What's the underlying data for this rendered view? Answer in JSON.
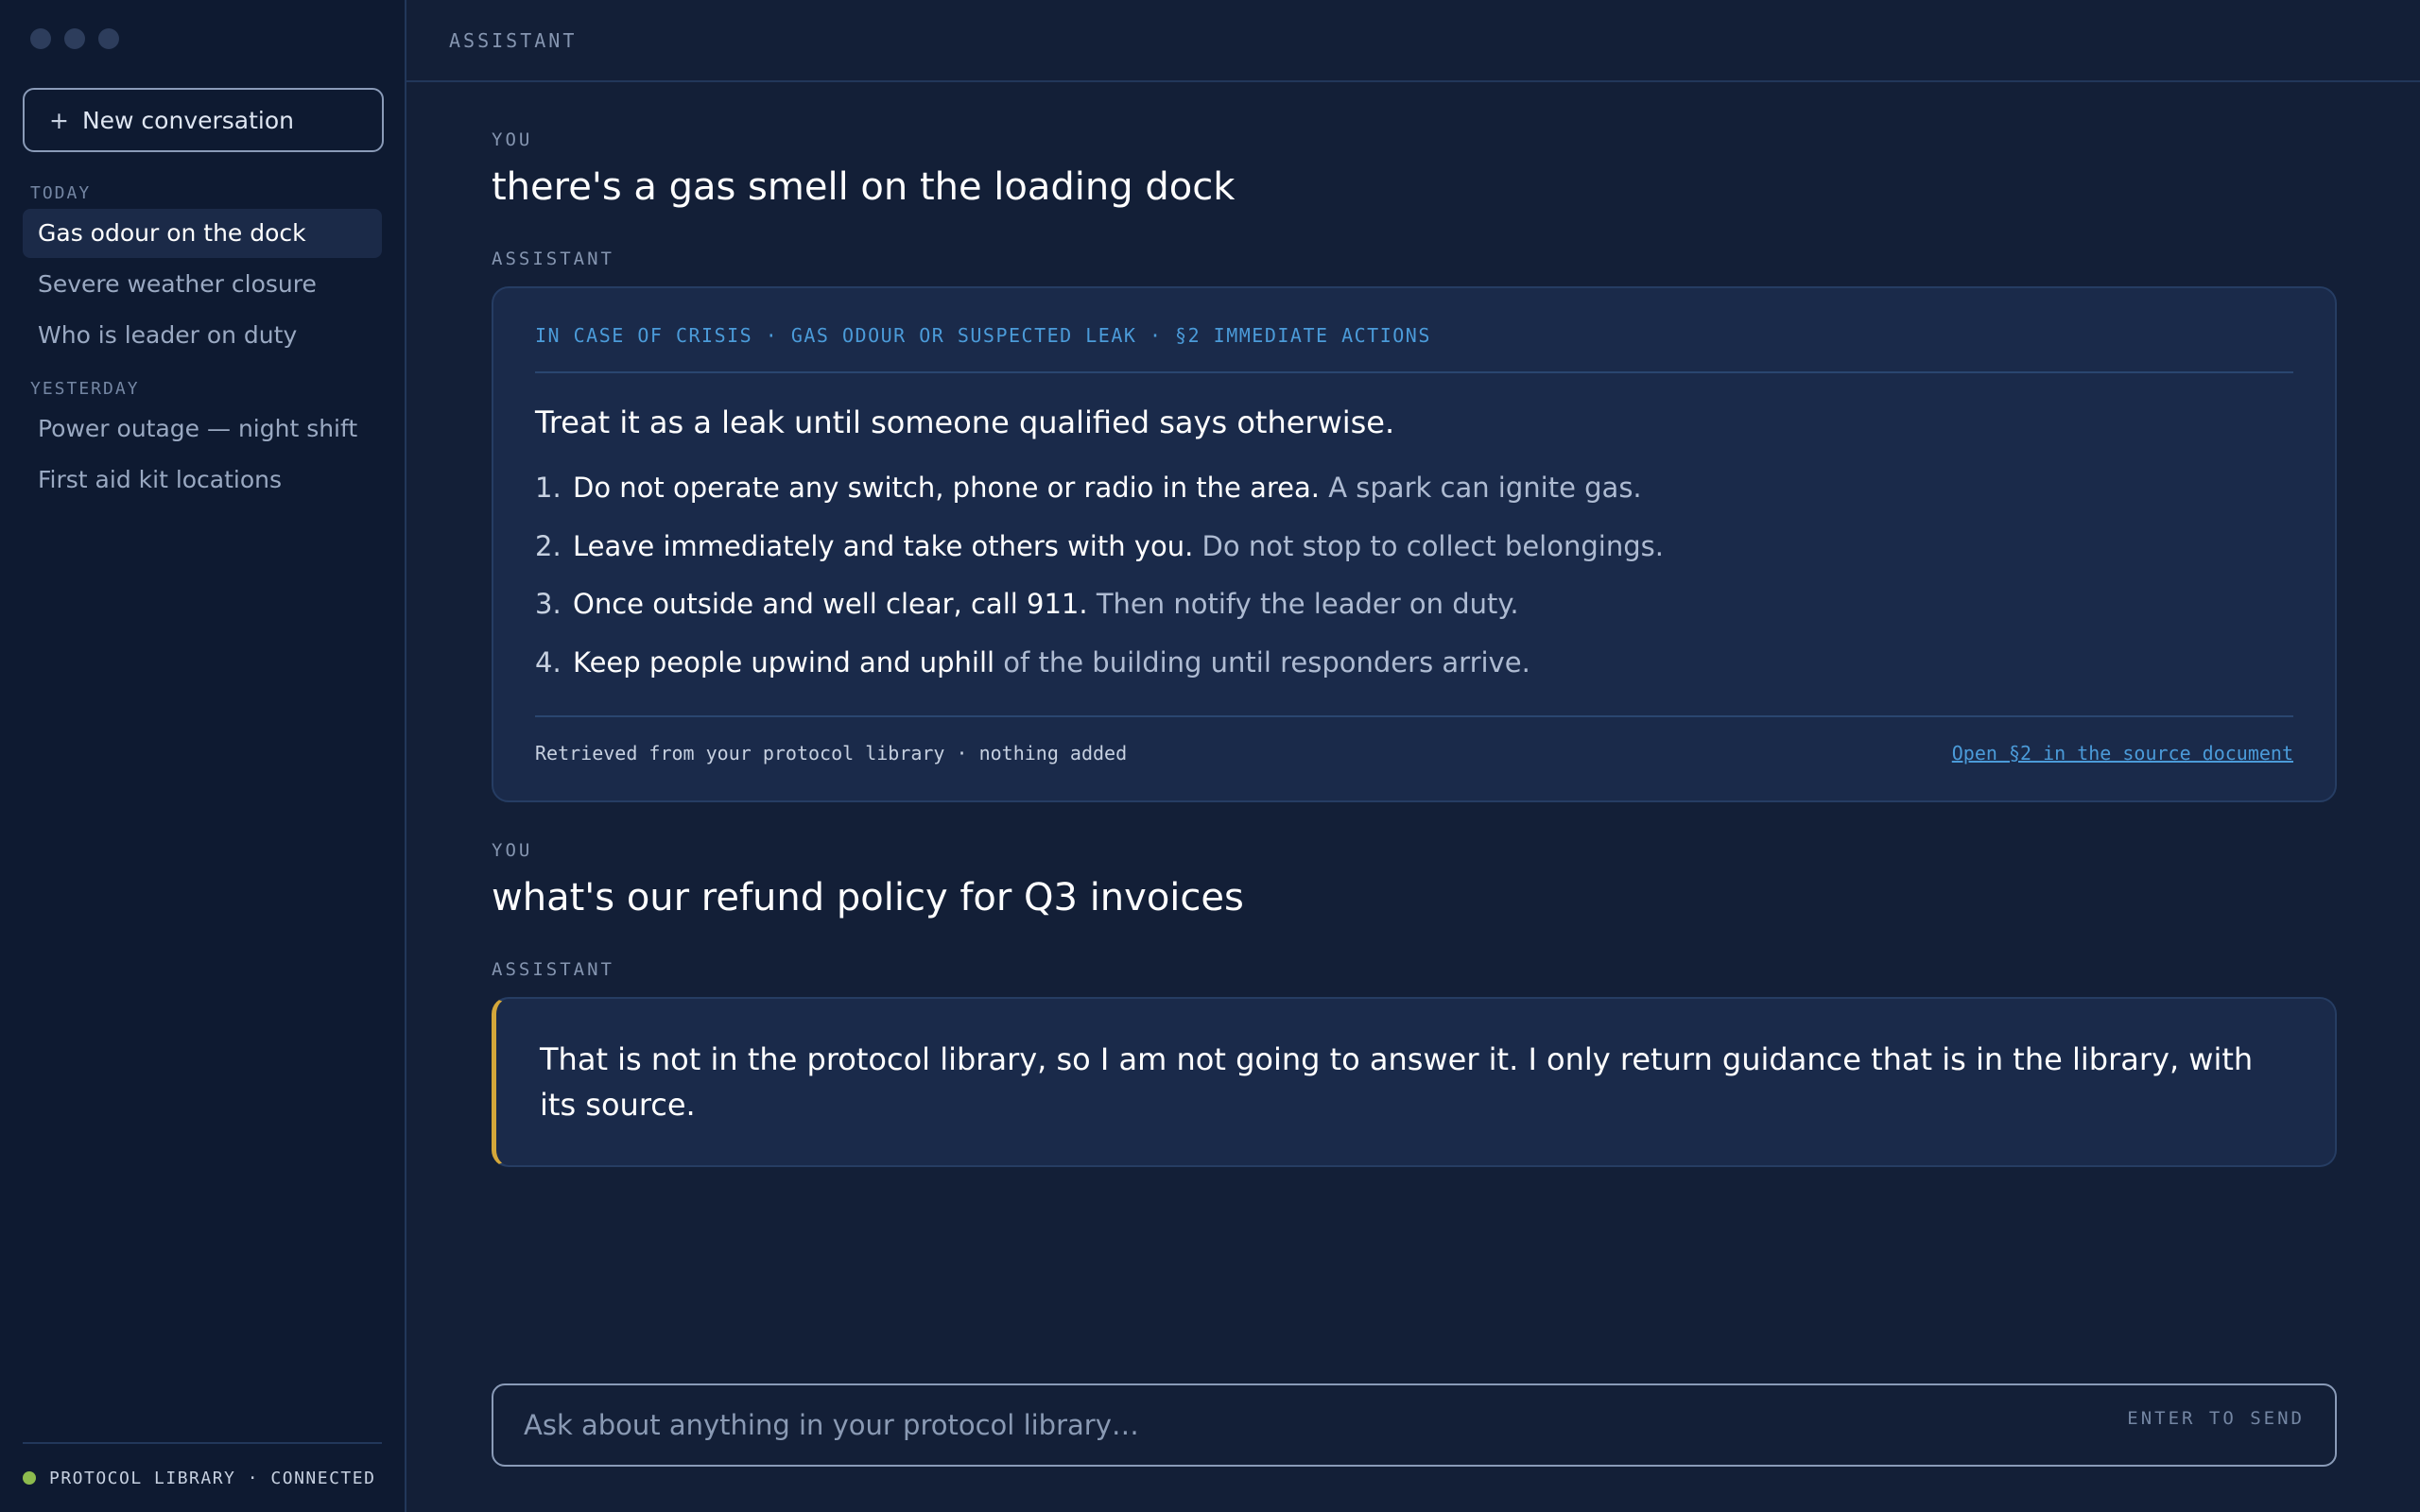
{
  "sidebar": {
    "new_conversation_icon": "+",
    "new_conversation_label": "New conversation",
    "today_label": "TODAY",
    "today_items": [
      {
        "label": "Gas odour on the dock"
      },
      {
        "label": "Severe weather closure"
      },
      {
        "label": "Who is leader on duty"
      }
    ],
    "yesterday_label": "YESTERDAY",
    "yesterday_items": [
      {
        "label": "Power outage — night shift"
      },
      {
        "label": "First aid kit locations"
      }
    ],
    "footer_status": "PROTOCOL LIBRARY · CONNECTED",
    "status_color": "#8dbb4e"
  },
  "header": {
    "title": "ASSISTANT"
  },
  "thread": {
    "messages": [
      {
        "role": "YOU",
        "text": "there's a gas smell on the loading dock"
      },
      {
        "role": "ASSISTANT",
        "card": {
          "heading": "IN CASE OF CRISIS · GAS ODOUR OR SUSPECTED LEAK · §2 IMMEDIATE ACTIONS",
          "lead": "Treat it as a leak until someone qualified says otherwise.",
          "steps": [
            {
              "num": "1.",
              "strong": "Do not operate any switch, phone or radio in the area.",
              "rest": " A spark can ignite gas."
            },
            {
              "num": "2.",
              "strong": "Leave immediately and take others with you.",
              "rest": " Do not stop to collect belongings."
            },
            {
              "num": "3.",
              "strong": "Once outside and well clear, call 911.",
              "rest": " Then notify the leader on duty."
            },
            {
              "num": "4.",
              "strong": "Keep people upwind and uphill",
              "rest": " of the building until responders arrive."
            }
          ],
          "footer_note": "Retrieved from your protocol library · nothing added",
          "source_link": "Open §2 in the source document"
        }
      },
      {
        "role": "YOU",
        "text": "what's our refund policy for Q3 invoices"
      },
      {
        "role": "ASSISTANT",
        "refusal": "That is not in the protocol library, so I am not going to answer it. I only return guidance that is in the library, with its source."
      }
    ]
  },
  "composer": {
    "placeholder": "Ask about anything in your protocol library…",
    "value": "",
    "hint": "ENTER TO SEND"
  },
  "colors": {
    "background": "#131f37",
    "sidebar": "#0e1a31",
    "card": "#1a2a4a",
    "accent_blue": "#4b9bd9",
    "refusal_accent": "#d4a73a"
  }
}
